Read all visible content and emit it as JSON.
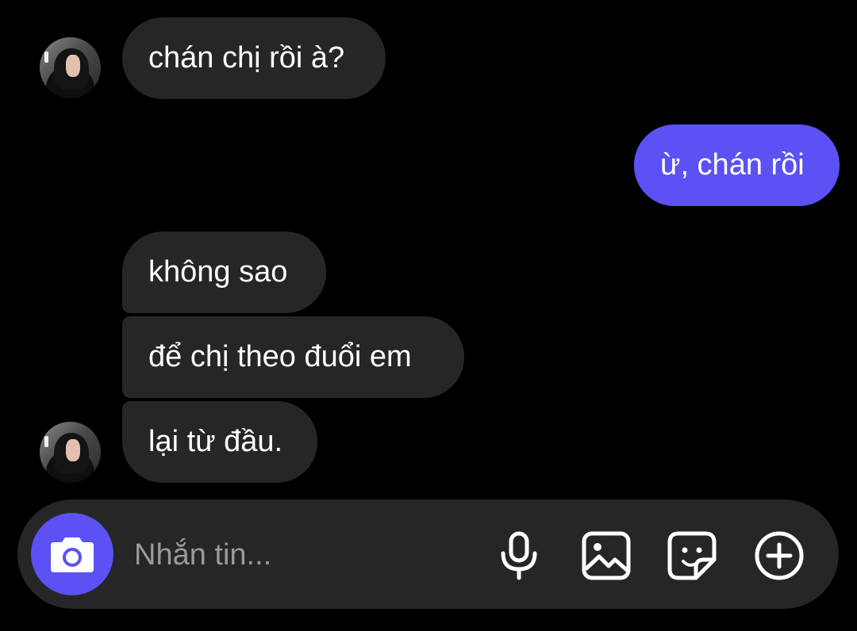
{
  "conversation": {
    "messages": [
      {
        "text": "chán chị rồi à?",
        "direction": "received"
      },
      {
        "text": "ừ, chán rồi",
        "direction": "sent"
      },
      {
        "text": "không sao",
        "direction": "received"
      },
      {
        "text": "để chị theo đuổi em",
        "direction": "received"
      },
      {
        "text": "lại từ đầu.",
        "direction": "received"
      }
    ]
  },
  "composer": {
    "placeholder": "Nhắn tin...",
    "icons": [
      "camera-icon",
      "microphone-icon",
      "gallery-icon",
      "sticker-icon",
      "add-icon"
    ]
  },
  "colors": {
    "background": "#000000",
    "received_bubble": "#262626",
    "sent_bubble": "#5b51f5",
    "composer_bg": "#262626",
    "placeholder": "#9a9a9a"
  }
}
